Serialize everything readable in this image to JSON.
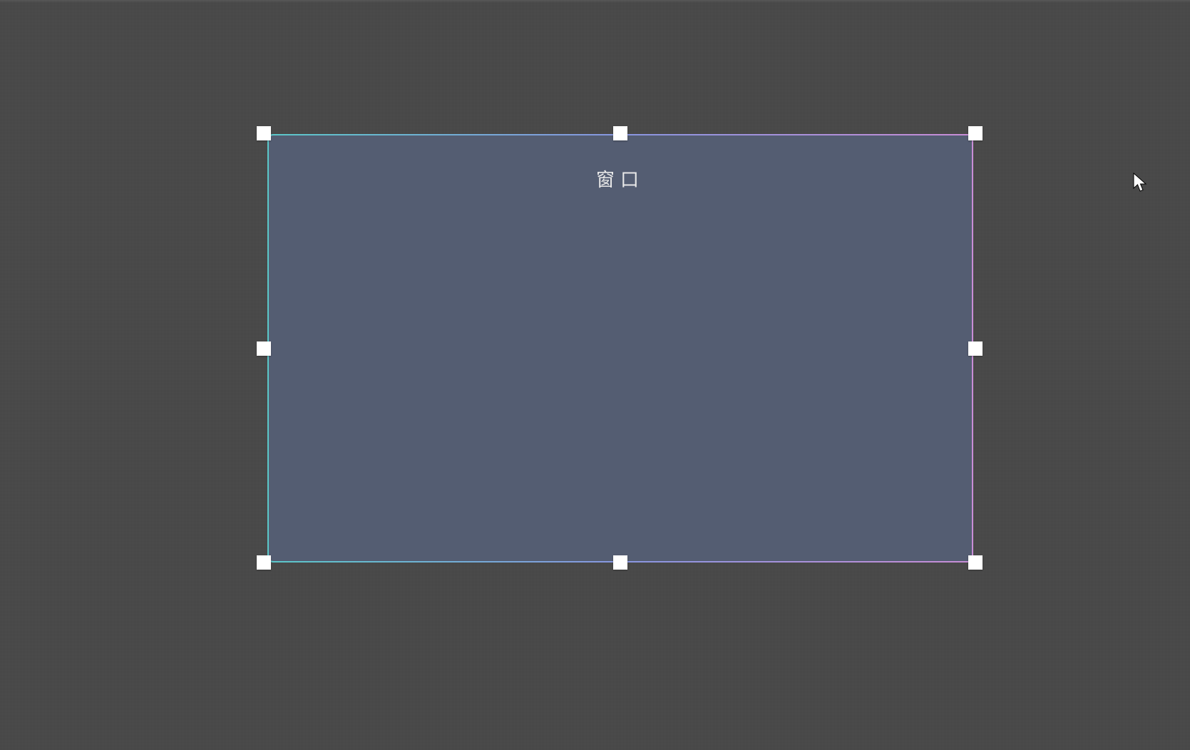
{
  "panel": {
    "title": "窗口"
  },
  "handles": {
    "nw": "resize-handle-nw",
    "n": "resize-handle-n",
    "ne": "resize-handle-ne",
    "w": "resize-handle-w",
    "e": "resize-handle-e",
    "sw": "resize-handle-sw",
    "s": "resize-handle-s",
    "se": "resize-handle-se"
  }
}
